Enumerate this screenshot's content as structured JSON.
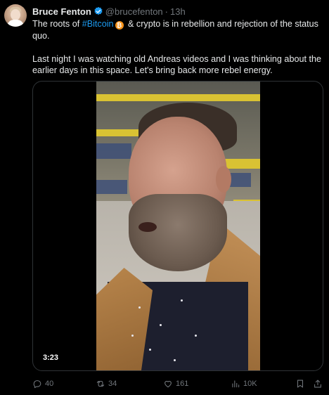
{
  "author": {
    "name": "Bruce Fenton",
    "handle": "@brucefenton",
    "separator": "·",
    "time": "13h",
    "verified": true,
    "verified_color": "#1d9bf0"
  },
  "tweet": {
    "line1_pre": "The roots of ",
    "hashtag": "#Bitcoin",
    "hashtag_emoji": "bitcoin-logo-icon",
    "line1_post": " & crypto is in rebellion and rejection of the status quo.",
    "paragraph2": "Last night I was watching old Andreas videos and I was thinking about the earlier days in this space.  Let's bring back more rebel energy."
  },
  "media": {
    "duration": "3:23"
  },
  "actions": {
    "replies": "40",
    "reposts": "34",
    "likes": "161",
    "views": "10K",
    "reply_icon": "reply-icon",
    "repost_icon": "repost-icon",
    "like_icon": "heart-icon",
    "views_icon": "views-chart-icon",
    "bookmark_icon": "bookmark-icon",
    "share_icon": "share-icon"
  },
  "colors": {
    "background": "#000000",
    "text": "#e7e9ea",
    "muted": "#71767b",
    "accent": "#1d9bf0",
    "bitcoin": "#f7931a"
  }
}
